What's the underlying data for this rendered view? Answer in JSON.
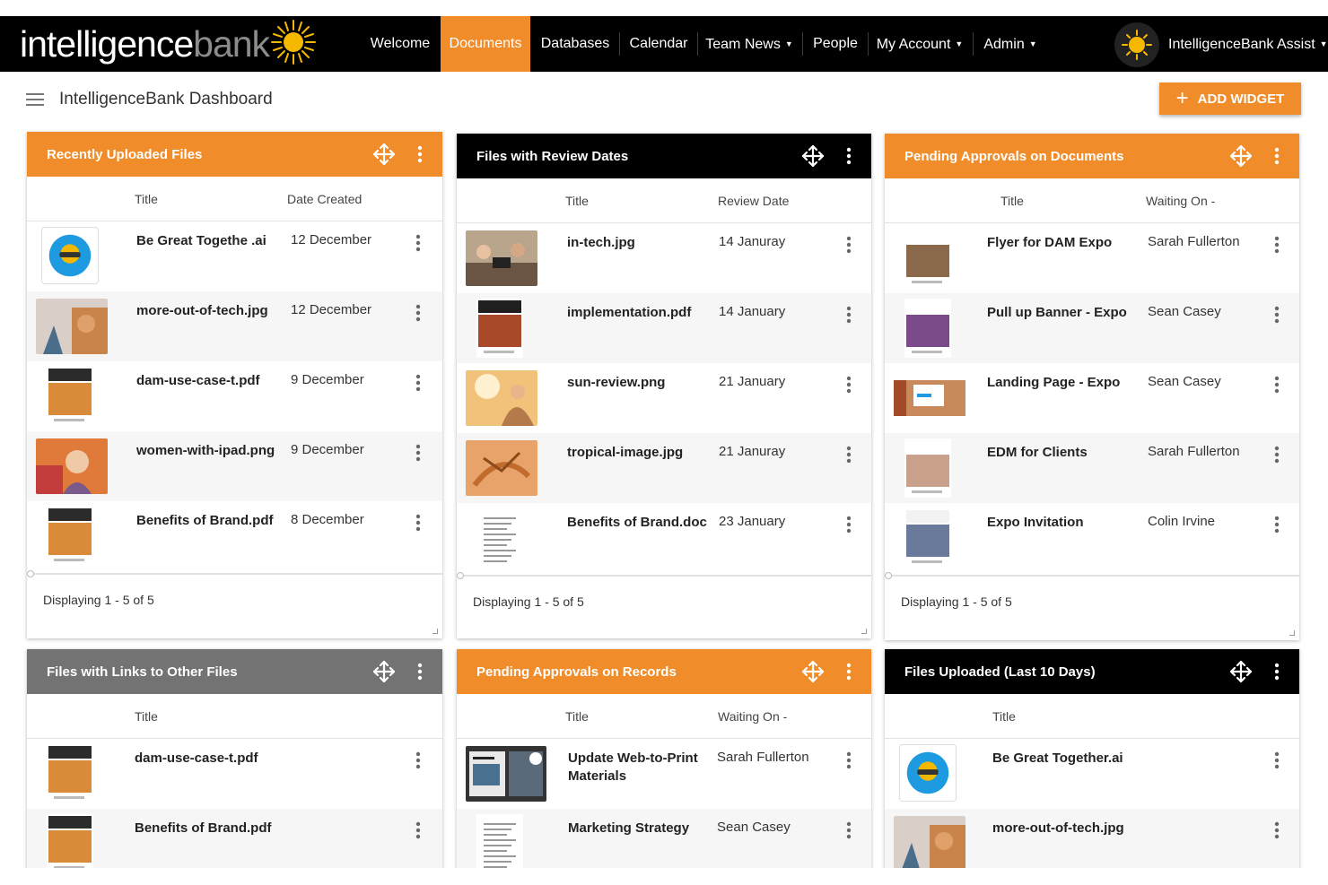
{
  "nav": {
    "logo_part1": "intelligence",
    "logo_part2": "bank",
    "items": [
      {
        "label": "Welcome",
        "dropdown": false
      },
      {
        "label": "Documents",
        "dropdown": false,
        "active": true
      },
      {
        "label": "Databases",
        "dropdown": false
      },
      {
        "label": "Calendar",
        "dropdown": false
      },
      {
        "label": "Team News",
        "dropdown": true
      },
      {
        "label": "People",
        "dropdown": false
      },
      {
        "label": "My Account",
        "dropdown": true
      },
      {
        "label": "Admin",
        "dropdown": true
      }
    ],
    "assist_label": "IntelligenceBank Assist",
    "caret": "▼",
    "accent_color": "#f08c2a"
  },
  "header": {
    "title": "IntelligenceBank Dashboard",
    "add_widget_label": "ADD WIDGET",
    "add_widget_icon": "+"
  },
  "widgets": [
    {
      "title": "Recently Uploaded Files",
      "header_color": "orange",
      "columns": [
        "Title",
        "Date Created"
      ],
      "rows": [
        {
          "title": "Be Great Togethe .ai",
          "value": "12 December",
          "thumb": "logo-ai"
        },
        {
          "title": "more-out-of-tech.jpg",
          "value": "12 December",
          "thumb": "photo-tech"
        },
        {
          "title": "dam-use-case-t.pdf",
          "value": "9 December",
          "thumb": "doc-orange"
        },
        {
          "title": "women-with-ipad.png",
          "value": "9 December",
          "thumb": "photo-woman"
        },
        {
          "title": "Benefits of Brand.pdf",
          "value": "8 December",
          "thumb": "doc-orange"
        }
      ],
      "footer": "Displaying 1 - 5 of 5"
    },
    {
      "title": "Files with Review Dates",
      "header_color": "black",
      "columns": [
        "Title",
        "Review Date"
      ],
      "rows": [
        {
          "title": "in-tech.jpg",
          "value": "14 Januray",
          "thumb": "photo-meeting"
        },
        {
          "title": "implementation.pdf",
          "value": "14 January",
          "thumb": "doc-red"
        },
        {
          "title": "sun-review.png",
          "value": "21 January",
          "thumb": "photo-sun"
        },
        {
          "title": "tropical-image.jpg",
          "value": "21 Januray",
          "thumb": "photo-tropical"
        },
        {
          "title": "Benefits of Brand.doc",
          "value": "23 January",
          "thumb": "doc-text"
        }
      ],
      "footer": "Displaying 1 - 5 of 5"
    },
    {
      "title": "Pending Approvals on Documents",
      "header_color": "orange",
      "columns": [
        "Title",
        "Waiting On -"
      ],
      "rows": [
        {
          "title": "Flyer for DAM Expo",
          "value": "Sarah Fullerton",
          "thumb": "doc-flyer"
        },
        {
          "title": "Pull up Banner - Expo",
          "value": "Sean Casey",
          "thumb": "doc-banner"
        },
        {
          "title": "Landing Page - Expo",
          "value": "Sean Casey",
          "thumb": "photo-landing"
        },
        {
          "title": "EDM for Clients",
          "value": "Sarah Fullerton",
          "thumb": "doc-edm"
        },
        {
          "title": "Expo Invitation",
          "value": "Colin Irvine",
          "thumb": "doc-invite"
        }
      ],
      "footer": "Displaying 1 - 5 of 5"
    },
    {
      "title": "Files with Links to Other Files",
      "header_color": "gray",
      "columns": [
        "Title"
      ],
      "rows": [
        {
          "title": "dam-use-case-t.pdf",
          "value": "",
          "thumb": "doc-orange"
        },
        {
          "title": "Benefits of Brand.pdf",
          "value": "",
          "thumb": "doc-orange"
        }
      ]
    },
    {
      "title": "Pending Approvals on Records",
      "header_color": "orange",
      "columns": [
        "Title",
        "Waiting On -"
      ],
      "rows": [
        {
          "title": "Update Web-to-Print",
          "title2": "Materials",
          "value": "Sarah Fullerton",
          "thumb": "photo-print"
        },
        {
          "title": "Marketing Strategy",
          "value": "Sean Casey",
          "thumb": "doc-text"
        }
      ]
    },
    {
      "title": "Files Uploaded (Last 10 Days)",
      "header_color": "black",
      "columns": [
        "Title"
      ],
      "rows": [
        {
          "title": "Be Great Together.ai",
          "value": "",
          "thumb": "logo-ai"
        },
        {
          "title": "more-out-of-tech.jpg",
          "value": "",
          "thumb": "photo-tech"
        }
      ]
    }
  ]
}
